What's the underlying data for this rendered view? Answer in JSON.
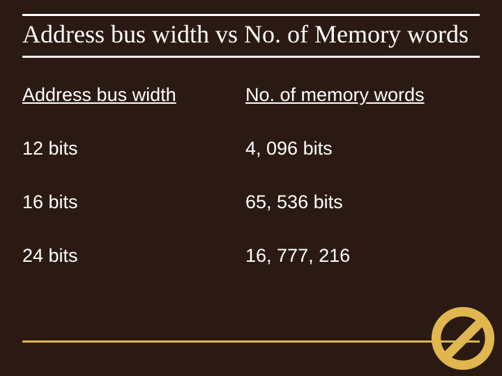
{
  "title": "Address bus width  vs  No. of Memory words",
  "headers": {
    "left": "Address bus width",
    "right": "No. of memory words"
  },
  "rows": [
    {
      "left": "12 bits",
      "right": "4, 096 bits"
    },
    {
      "left": "16 bits",
      "right": "65, 536 bits"
    },
    {
      "left": "24 bits",
      "right": "16, 777, 216"
    }
  ],
  "icons": {
    "prohibit": "no-entry-icon"
  },
  "colors": {
    "accent": "#e0b64e",
    "background": "#2b1a13",
    "text": "#ffffff"
  },
  "chart_data": {
    "type": "table",
    "title": "Address bus width vs No. of Memory words",
    "columns": [
      "Address bus width",
      "No. of memory words"
    ],
    "rows": [
      [
        "12 bits",
        "4, 096 bits"
      ],
      [
        "16 bits",
        "65, 536 bits"
      ],
      [
        "24 bits",
        "16, 777, 216"
      ]
    ]
  }
}
